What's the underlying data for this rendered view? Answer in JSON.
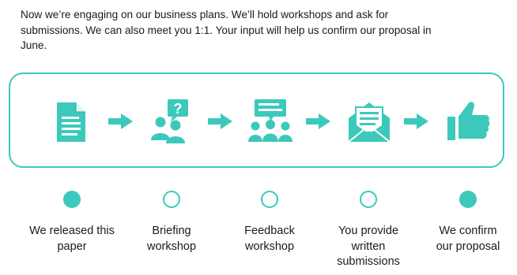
{
  "intro": {
    "line1": "Now we’re engaging on our business plans.  We’ll hold workshops and ask for",
    "line2": "submissions.  We can also meet you 1:1.  Your input will help us confirm our proposal in",
    "line3": "June."
  },
  "accent_color": "#3cc9bc",
  "steps": [
    {
      "icon": "document-icon",
      "label": "We released this\npaper",
      "status": "completed"
    },
    {
      "icon": "briefing-icon",
      "label": "Briefing\nworkshop",
      "status": "pending"
    },
    {
      "icon": "workshop-icon",
      "label": "Feedback\nworkshop",
      "status": "pending"
    },
    {
      "icon": "envelope-icon",
      "label": "You provide\nwritten\nsubmissions",
      "status": "pending"
    },
    {
      "icon": "thumbs-up-icon",
      "label": "We confirm\nour proposal",
      "status": "completed"
    }
  ]
}
